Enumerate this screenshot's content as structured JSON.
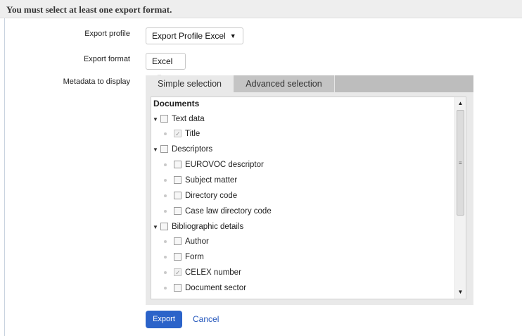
{
  "error_message": "You must select at least one export format.",
  "form": {
    "export_profile_label": "Export profile",
    "export_profile_value": "Export Profile Excel",
    "export_format_label": "Export format",
    "export_format_value": "Excel",
    "metadata_label": "Metadata to display"
  },
  "tabs": {
    "simple": "Simple selection",
    "advanced": "Advanced selection"
  },
  "tree": {
    "heading": "Documents",
    "items": [
      {
        "label": "Text data",
        "level": 0,
        "checked": false
      },
      {
        "label": "Title",
        "level": 1,
        "checked": true
      },
      {
        "label": "Descriptors",
        "level": 0,
        "checked": false
      },
      {
        "label": "EUROVOC descriptor",
        "level": 1,
        "checked": false
      },
      {
        "label": "Subject matter",
        "level": 1,
        "checked": false
      },
      {
        "label": "Directory code",
        "level": 1,
        "checked": false
      },
      {
        "label": "Case law directory code",
        "level": 1,
        "checked": false
      },
      {
        "label": "Bibliographic details",
        "level": 0,
        "checked": false
      },
      {
        "label": "Author",
        "level": 1,
        "checked": false
      },
      {
        "label": "Form",
        "level": 1,
        "checked": false
      },
      {
        "label": "CELEX number",
        "level": 1,
        "checked": true
      },
      {
        "label": "Document sector",
        "level": 1,
        "checked": false
      }
    ]
  },
  "buttons": {
    "export": "Export",
    "cancel": "Cancel"
  },
  "colors": {
    "primary": "#2b63c9",
    "link": "#2255bb"
  }
}
